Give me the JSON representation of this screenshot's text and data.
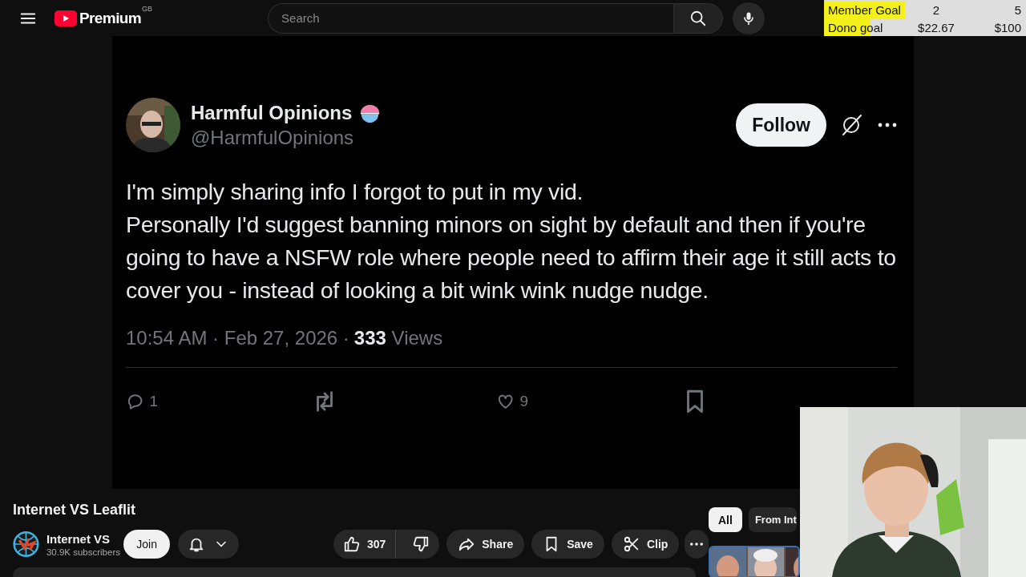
{
  "header": {
    "logo": "Premium",
    "region": "GB",
    "search": {
      "placeholder": "Search"
    }
  },
  "goals": [
    {
      "label": "Member Goal",
      "current": "2",
      "target": "5",
      "level": 0.4
    },
    {
      "label": "Dono goal",
      "current": "$22.67",
      "target": "$100",
      "level": 0.23
    }
  ],
  "tweet": {
    "name": "Harmful Opinions",
    "handle": "@HarmfulOpinions",
    "follow": "Follow",
    "paragraphs": [
      "I'm simply sharing info I forgot to put in my vid.",
      "Personally I'd suggest banning minors on sight by default and then if you're going to have a NSFW role where people need to affirm their age it still acts to cover you - instead of looking a bit wink wink nudge nudge."
    ],
    "timestamp": "10:54 AM · Feb 27, 2026 ·",
    "views": "333",
    "views_label": "Views",
    "actions": [
      {
        "kind": "reply",
        "count": "1"
      },
      {
        "kind": "repost"
      },
      {
        "kind": "like",
        "count": "9"
      },
      {
        "kind": "bookmark"
      }
    ]
  },
  "video": {
    "title": "Internet VS Leaflit",
    "channel": {
      "name": "Internet VS",
      "subscribers": "30.9K subscribers"
    },
    "join": "Join",
    "likes": "307",
    "buttons": [
      {
        "kind": "share",
        "label": "Share"
      },
      {
        "kind": "save",
        "label": "Save"
      },
      {
        "kind": "clip",
        "label": "Clip"
      }
    ]
  },
  "chips": [
    {
      "label": "All",
      "selected": true
    },
    {
      "label": "From Int",
      "selected": false
    }
  ]
}
